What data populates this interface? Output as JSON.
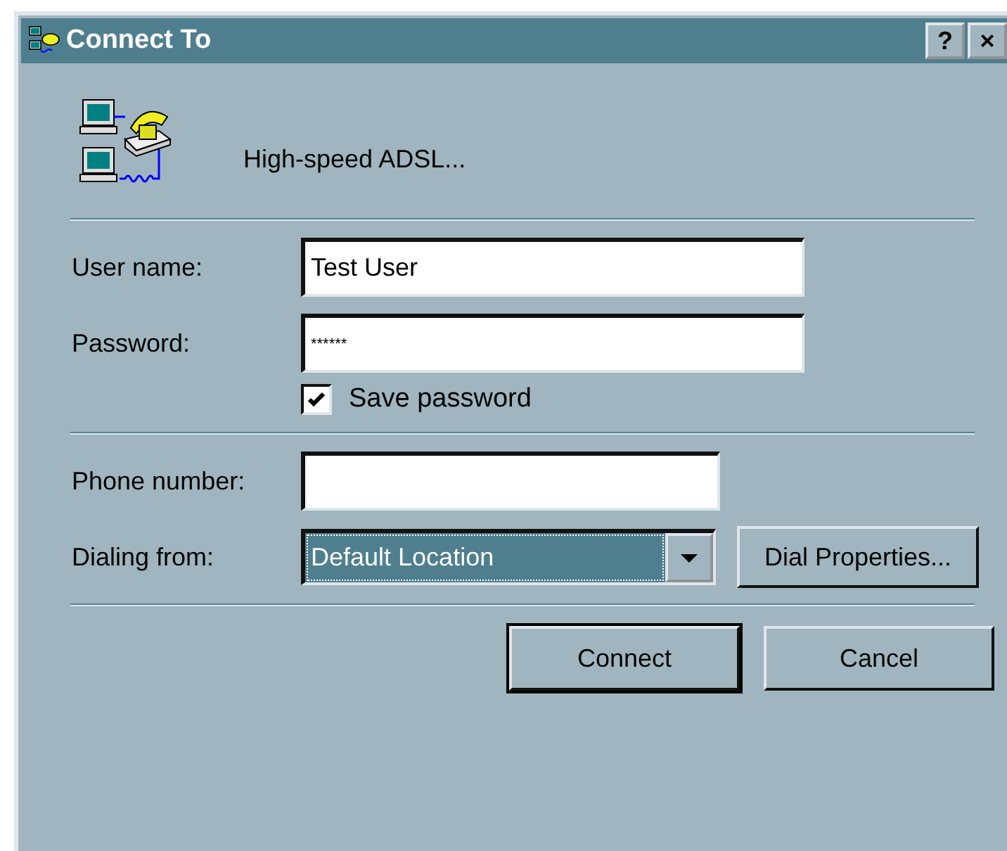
{
  "window": {
    "title": "Connect To",
    "title_buttons": [
      "?",
      "×"
    ]
  },
  "connection": {
    "name": "High-speed ADSL..."
  },
  "fields": [
    {
      "label": "User name:",
      "value": "Test User",
      "kind": "text"
    },
    {
      "label": "Password:",
      "value": "******",
      "kind": "text"
    }
  ],
  "save_password": {
    "label": "Save password",
    "checked": true
  },
  "phone": {
    "label": "Phone number:"
  },
  "dialing": {
    "label": "Dialing from:",
    "value": "Default Location",
    "button": "Dial Properties..."
  },
  "buttons": [
    {
      "label": "Connect",
      "default": true
    },
    {
      "label": "Cancel",
      "default": false
    }
  ]
}
